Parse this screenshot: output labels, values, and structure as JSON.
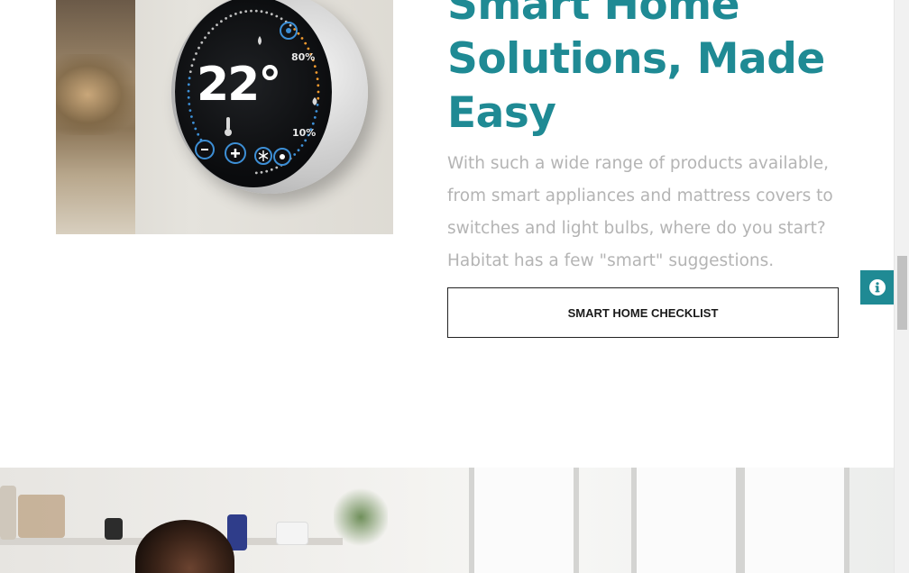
{
  "hero_image": {
    "temperature": "22°",
    "humidity_high": "80%",
    "humidity_low": "10%",
    "icons": [
      "fan-icon",
      "droplet-icon",
      "thermometer-icon",
      "minus-icon",
      "plus-icon",
      "snowflake-icon",
      "sun-icon"
    ]
  },
  "section": {
    "heading": "Smart Home Solutions, Made Easy",
    "body": "With such a wide range of products available, from smart appliances and mattress covers to switches and light bulbs, where do you start? Habitat has a few \"smart\" suggestions.",
    "cta_label": "SMART HOME CHECKLIST"
  },
  "info_button": {
    "icon": "info-icon"
  },
  "colors": {
    "accent": "#1f8a94",
    "body_text": "#b4b4b4",
    "button_border": "#222222",
    "scroll_thumb": "#c1c1c1"
  }
}
